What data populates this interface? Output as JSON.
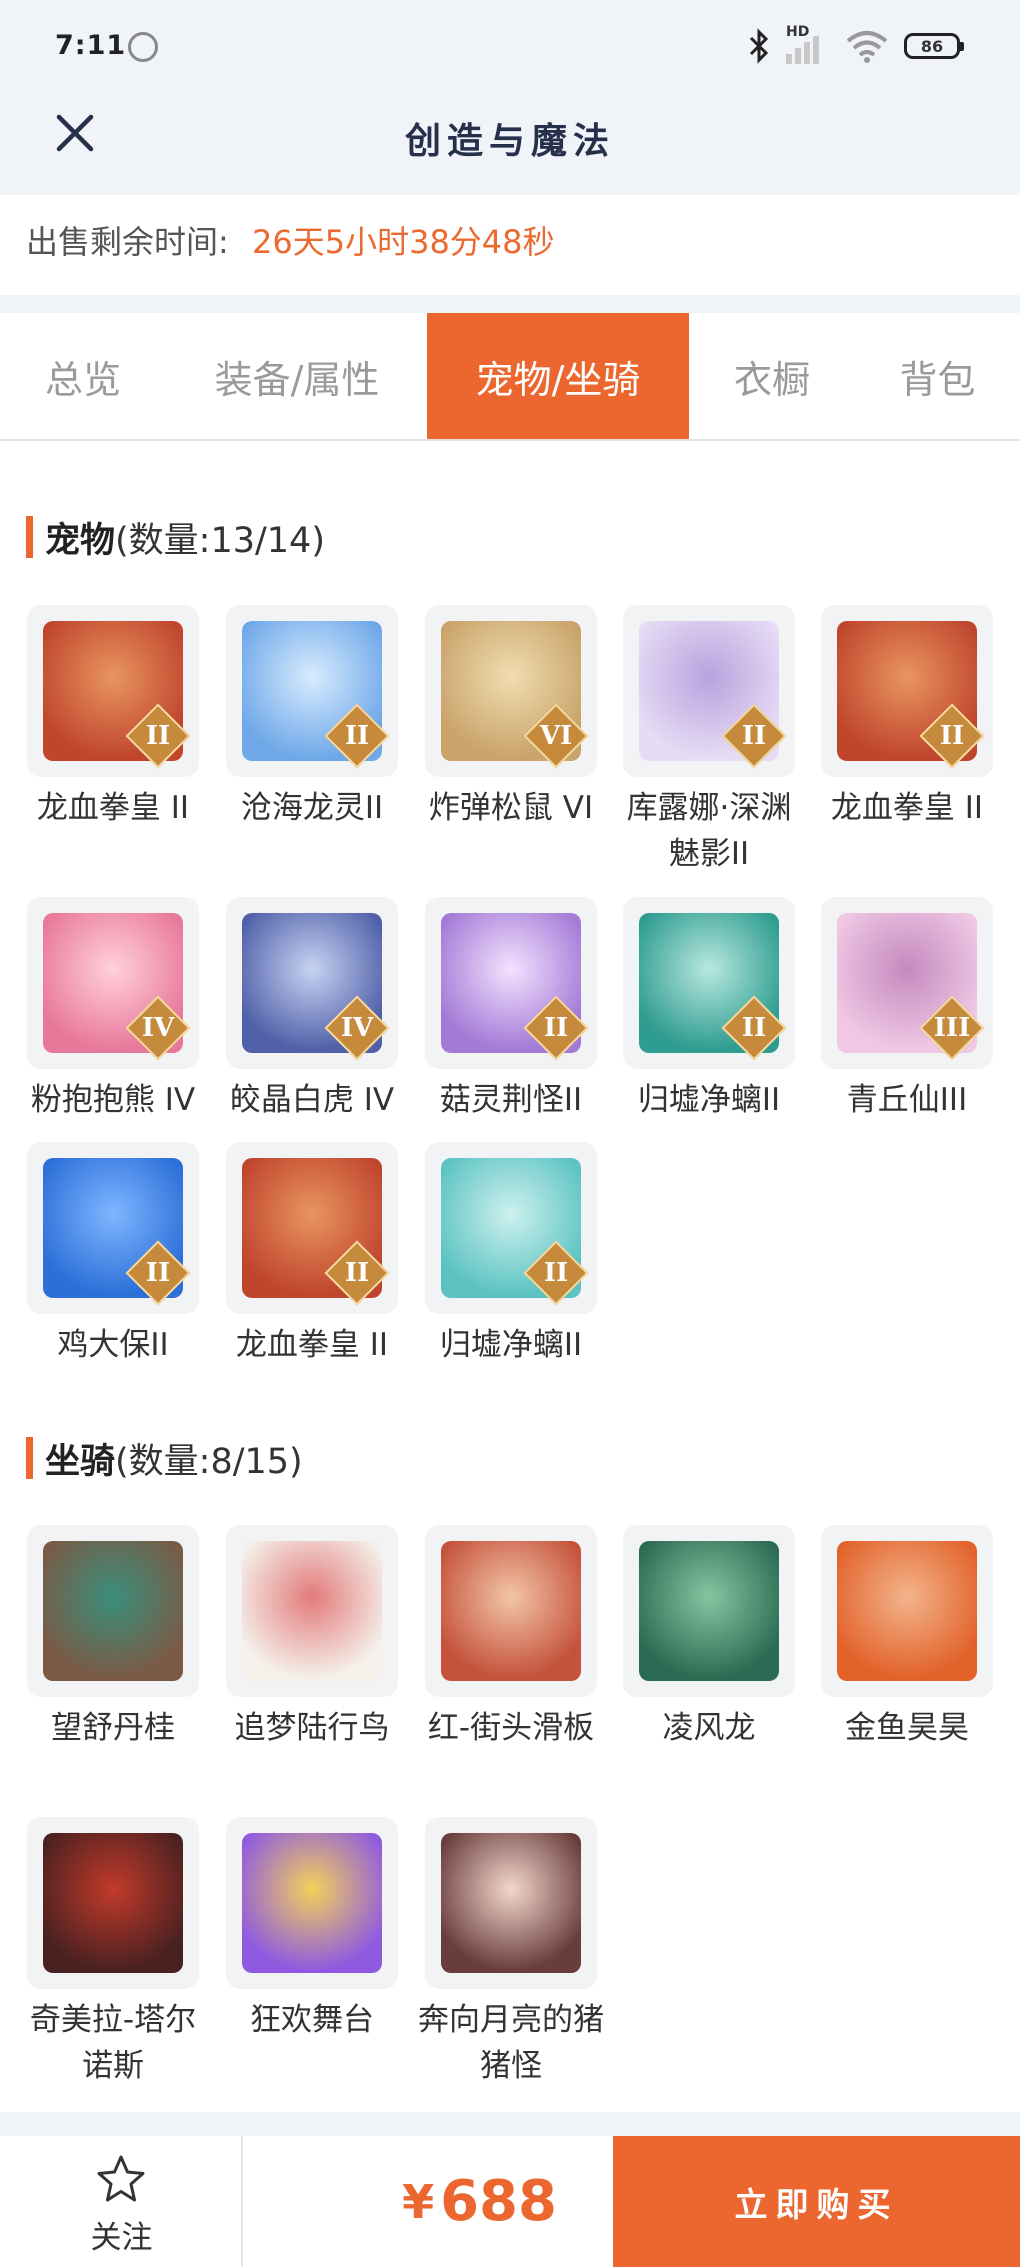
{
  "status_bar": {
    "time": "7:11",
    "battery": "86",
    "network_label": "HD"
  },
  "header": {
    "title": "创造与魔法",
    "close_icon": "close-icon"
  },
  "sale": {
    "label": "出售剩余时间:",
    "remaining": "26天5小时38分48秒"
  },
  "tabs": [
    {
      "label": "总览",
      "active": false
    },
    {
      "label": "装备/属性",
      "active": false
    },
    {
      "label": "宠物/坐骑",
      "active": true
    },
    {
      "label": "衣橱",
      "active": false
    },
    {
      "label": "背包",
      "active": false
    }
  ],
  "pets": {
    "title": "宠物",
    "count": "(数量:13/14)",
    "items": [
      {
        "name": "龙血拳皇 II",
        "badge": "II"
      },
      {
        "name": "沧海龙灵II",
        "badge": "II"
      },
      {
        "name": "炸弹松鼠 VI",
        "badge": "VI"
      },
      {
        "name": "库露娜·深渊魅影II",
        "badge": "II"
      },
      {
        "name": "龙血拳皇 II",
        "badge": "II"
      },
      {
        "name": "粉抱抱熊 IV",
        "badge": "IV"
      },
      {
        "name": "皎晶白虎 IV",
        "badge": "IV"
      },
      {
        "name": "菇灵荆怪II",
        "badge": "II"
      },
      {
        "name": "归墟净螭II",
        "badge": "II"
      },
      {
        "name": "青丘仙III",
        "badge": "III"
      },
      {
        "name": "鸡大保II",
        "badge": "II"
      },
      {
        "name": "龙血拳皇 II",
        "badge": "II"
      },
      {
        "name": "归墟净螭II",
        "badge": "II"
      }
    ]
  },
  "mounts": {
    "title": "坐骑",
    "count": "(数量:8/15)",
    "items": [
      {
        "name": "望舒丹桂"
      },
      {
        "name": "追梦陆行鸟"
      },
      {
        "name": "红-街头滑板"
      },
      {
        "name": "凌风龙"
      },
      {
        "name": "金鱼昊昊"
      },
      {
        "name": "奇美拉-塔尔诺斯"
      },
      {
        "name": "狂欢舞台"
      },
      {
        "name": "奔向月亮的猪猪怪"
      }
    ]
  },
  "footer": {
    "follow_label": "关注",
    "price_symbol": "¥",
    "price": "688",
    "buy_label": "立即购买"
  },
  "colors": {
    "accent": "#ec6730",
    "header_bg": "#f0f3f8",
    "title": "#26304a"
  }
}
